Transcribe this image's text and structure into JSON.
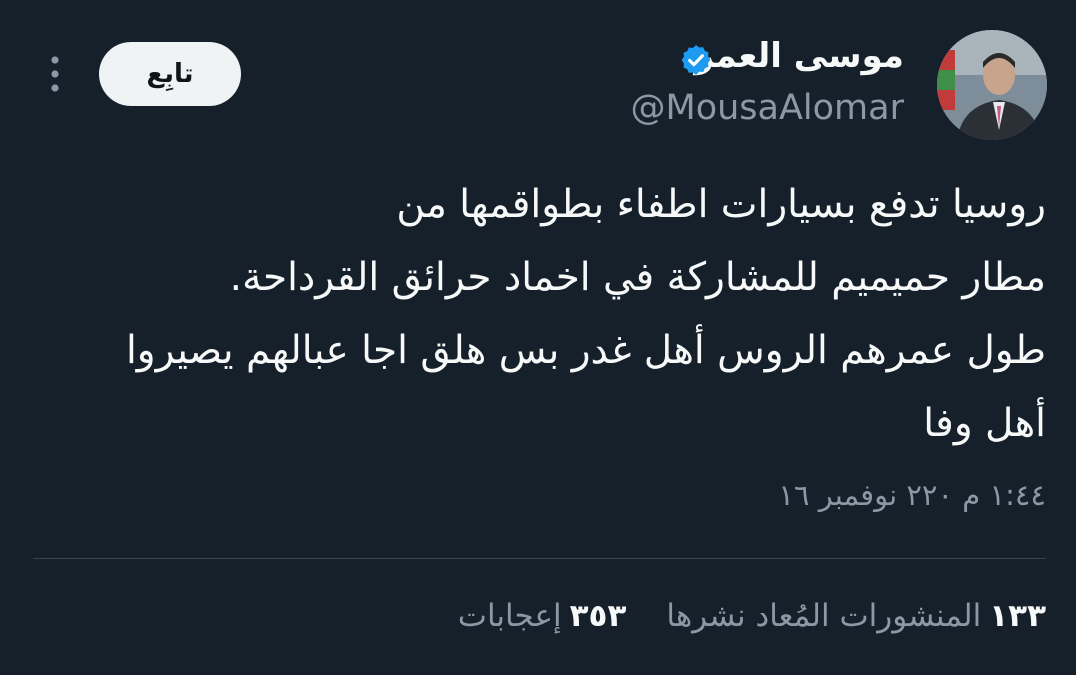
{
  "author": {
    "display_name": "موسى العمر",
    "handle": "@MousaAlomar",
    "verified": true
  },
  "actions": {
    "follow_label": "تابِع"
  },
  "tweet": {
    "text": "روسيا تدفع بسيارات اطفاء بطواقمها من\nمطار حميميم للمشاركة في اخماد حرائق القرداحة.\nطول عمرهم الروس أهل غدر بس هلق اجا عبالهم يصيروا\nأهل وفا",
    "timestamp": "١:٤٤ م ٢٢٠ نوفمبر ١٦"
  },
  "stats": {
    "reposts_count": "١٣٣",
    "reposts_label": "المنشورات المُعاد نشرها",
    "likes_count": "٣٥٣",
    "likes_label": "إعجابات"
  },
  "colors": {
    "background": "#15202b",
    "verified": "#1d9bf0",
    "secondary_text": "#8b98a5"
  }
}
